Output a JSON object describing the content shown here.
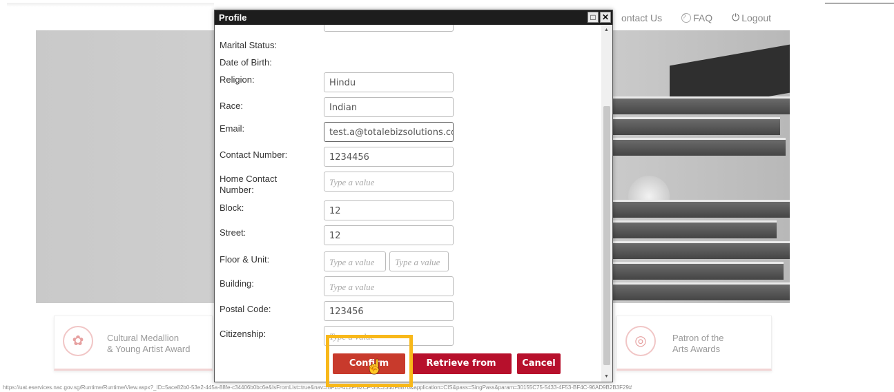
{
  "nav": {
    "contact_us": "ontact Us",
    "faq": "FAQ",
    "logout": "Logout"
  },
  "awards": {
    "left": {
      "line1": "Cultural Medallion",
      "line2": "& Young Artist Award"
    },
    "right": {
      "line1": "Patron of the",
      "line2": "Arts Awards"
    }
  },
  "status_url": "https://uat.eservices.nac.gov.sg/Runtime/Runtime/View.aspx?_ID=5ace82b0-53e2-445a-88fe-c34406b0bc6e&IsFromList=true&nav=f8F10-412F-82CF-35C2340F8870&application=CIS&pass=SingPass&param=30155C75-5433-4F53-BF4C-96AD9B2B3F29#",
  "dialog": {
    "title": "Profile",
    "fields": [
      {
        "label": "Marital Status:"
      },
      {
        "label": "Date of Birth:"
      },
      {
        "label": "Religion:",
        "value": "Hindu"
      },
      {
        "label": "Race:",
        "value": "Indian"
      },
      {
        "label": "Email:",
        "value": "test.a@totalebizsolutions.co"
      },
      {
        "label": "Contact Number:",
        "value": "1234456"
      },
      {
        "label_line1": "Home Contact",
        "label_line2": "Number:",
        "placeholder": "Type a value"
      },
      {
        "label": "Block:",
        "value": "12"
      },
      {
        "label": "Street:",
        "value": "12"
      },
      {
        "label": "Floor & Unit:",
        "placeholder1": "Type a value",
        "placeholder2": "Type a value"
      },
      {
        "label": "Building:",
        "placeholder": "Type a value"
      },
      {
        "label": "Postal Code:",
        "value": "123456"
      },
      {
        "label": "Citizenship:",
        "placeholder": "Type a value"
      }
    ],
    "buttons": {
      "confirm": "Confirm Profile",
      "retrieve": "Retrieve from MyInfo",
      "cancel": "Cancel"
    }
  },
  "colors": {
    "header": "#1d1d1d",
    "button_red": "#b7102c",
    "highlight": "#f8b81a"
  }
}
